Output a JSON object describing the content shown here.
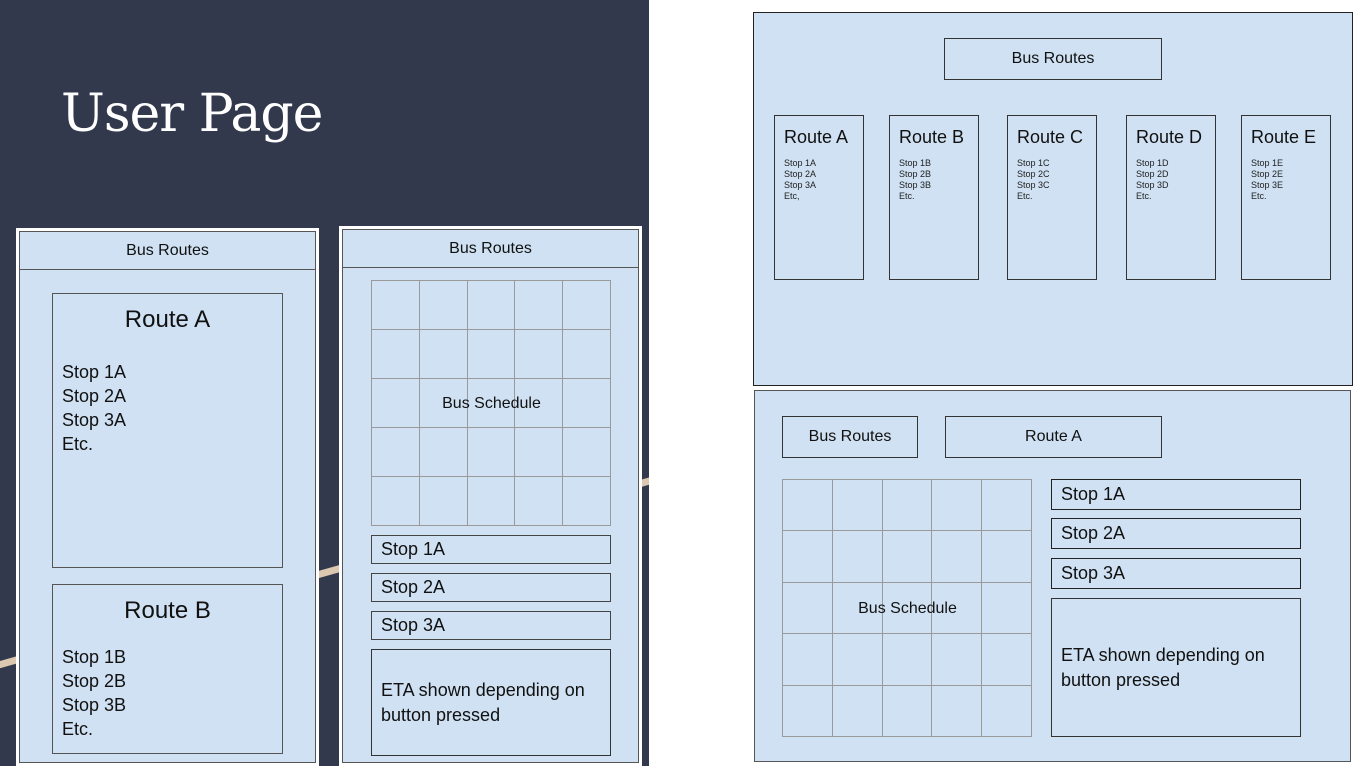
{
  "slide_title": "User Page",
  "colors": {
    "slide_bg": "#32394c",
    "mock_bg": "#cfe1f2",
    "accent_line": "#dcc7b0"
  },
  "mobile_list": {
    "header": "Bus Routes",
    "routes": [
      {
        "name": "Route A",
        "stops": [
          "Stop 1A",
          "Stop 2A",
          "Stop 3A",
          "Etc."
        ]
      },
      {
        "name": "Route B",
        "stops": [
          "Stop 1B",
          "Stop 2B",
          "Stop 3B",
          "Etc."
        ]
      }
    ]
  },
  "mobile_detail": {
    "header": "Bus Routes",
    "schedule_label": "Bus Schedule",
    "stop_buttons": [
      "Stop 1A",
      "Stop 2A",
      "Stop 3A"
    ],
    "eta_text": "ETA shown depending on button pressed"
  },
  "desktop_list": {
    "header": "Bus Routes",
    "routes": [
      {
        "name": "Route A",
        "stops": [
          "Stop 1A",
          "Stop 2A",
          "Stop 3A",
          "Etc,"
        ]
      },
      {
        "name": "Route B",
        "stops": [
          "Stop 1B",
          "Stop 2B",
          "Stop 3B",
          "Etc."
        ]
      },
      {
        "name": "Route C",
        "stops": [
          "Stop 1C",
          "Stop 2C",
          "Stop 3C",
          "Etc."
        ]
      },
      {
        "name": "Route D",
        "stops": [
          "Stop 1D",
          "Stop 2D",
          "Stop 3D",
          "Etc."
        ]
      },
      {
        "name": "Route E",
        "stops": [
          "Stop 1E",
          "Stop 2E",
          "Stop 3E",
          "Etc."
        ]
      }
    ]
  },
  "desktop_detail": {
    "back_button": "Bus Routes",
    "route_button": "Route A",
    "schedule_label": "Bus Schedule",
    "stop_buttons": [
      "Stop 1A",
      "Stop 2A",
      "Stop 3A"
    ],
    "eta_text": "ETA shown depending on button pressed"
  }
}
